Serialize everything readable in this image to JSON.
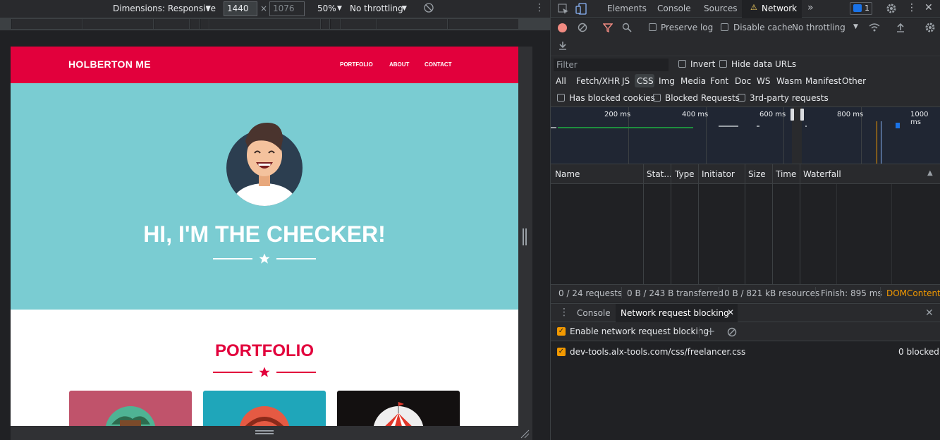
{
  "device_toolbar": {
    "dimensions_label": "Dimensions: Responsive",
    "width_value": "1440",
    "height_placeholder": "1076",
    "times": "×",
    "zoom": "50%",
    "throttling": "No throttling"
  },
  "site": {
    "brand": "HOLBERTON ME",
    "nav": [
      "PORTFOLIO",
      "ABOUT",
      "CONTACT"
    ],
    "hero_title": "HI, I'M THE CHECKER!",
    "portfolio_title": "PORTFOLIO",
    "colors": {
      "red": "#e2003c",
      "teal": "#7accd2"
    }
  },
  "devtools": {
    "tabs": [
      "Elements",
      "Console",
      "Sources",
      "Network"
    ],
    "active_tab": "Network",
    "issues_count": "1",
    "toolbar": {
      "preserve_log": "Preserve log",
      "disable_cache": "Disable cache",
      "throttling": "No throttling"
    },
    "filter": {
      "placeholder": "Filter",
      "invert": "Invert",
      "hide_data_urls": "Hide data URLs",
      "types": [
        "All",
        "Fetch/XHR",
        "JS",
        "CSS",
        "Img",
        "Media",
        "Font",
        "Doc",
        "WS",
        "Wasm",
        "Manifest",
        "Other"
      ],
      "active_type": "CSS",
      "has_blocked_cookies": "Has blocked cookies",
      "blocked_requests": "Blocked Requests",
      "third_party": "3rd-party requests"
    },
    "timeline_ticks": [
      "200 ms",
      "400 ms",
      "600 ms",
      "800 ms",
      "1000 ms"
    ],
    "columns": [
      "Name",
      "Stat...",
      "Type",
      "Initiator",
      "Size",
      "Time",
      "Waterfall"
    ],
    "status_bar": {
      "requests": "0 / 24 requests",
      "transferred": "0 B / 243 B transferred",
      "resources": "0 B / 821 kB resources",
      "finish": "Finish: 895 ms",
      "dcl": "DOMContentL"
    },
    "drawer": {
      "tabs": [
        "Console",
        "Network request blocking"
      ],
      "enable_label": "Enable network request blocking",
      "pattern": "dev-tools.alx-tools.com/css/freelancer.css",
      "blocked_count": "0 blocked"
    }
  }
}
